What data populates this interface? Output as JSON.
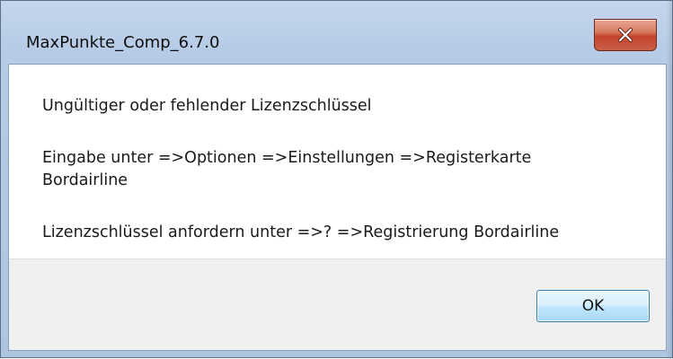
{
  "window": {
    "title": "MaxPunkte_Comp_6.7.0"
  },
  "message": {
    "line1": "Ungültiger oder fehlender Lizenzschlüssel",
    "line2a": "Eingabe unter =>Optionen =>Einstellungen =>Registerkarte",
    "line2b": "Bordairline",
    "line3": "Lizenzschlüssel anfordern unter =>? =>Registrierung Bordairline"
  },
  "buttons": {
    "ok_label": "OK"
  },
  "icons": {
    "close": "close-icon"
  },
  "colors": {
    "close_button": "#c3432b",
    "frame": "#b6cbe6",
    "button_bar": "#f0f0f0",
    "ok_border": "#3c7fb1"
  }
}
